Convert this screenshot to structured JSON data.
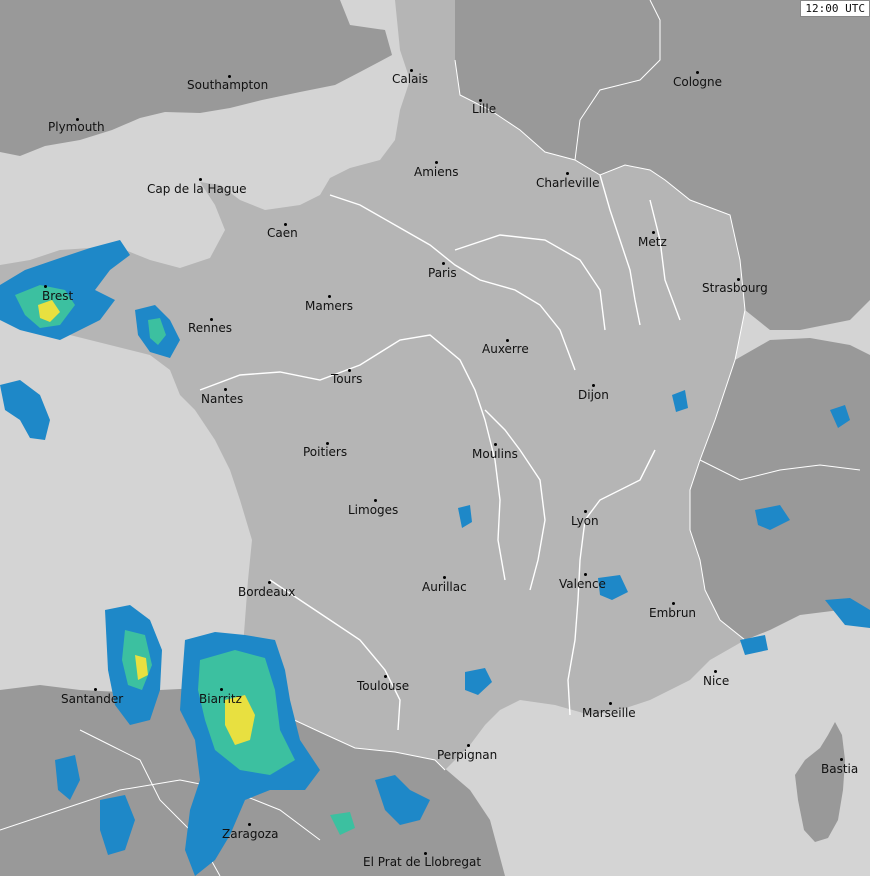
{
  "time_label": "12:00 UTC",
  "cities": {
    "southampton": "Southampton",
    "plymouth": "Plymouth",
    "calais": "Calais",
    "lille": "Lille",
    "cologne": "Cologne",
    "amiens": "Amiens",
    "charleville": "Charleville",
    "cap_de_la_hague": "Cap de la Hague",
    "caen": "Caen",
    "metz": "Metz",
    "paris": "Paris",
    "strasbourg": "Strasbourg",
    "brest": "Brest",
    "rennes": "Rennes",
    "mamers": "Mamers",
    "auxerre": "Auxerre",
    "tours": "Tours",
    "dijon": "Dijon",
    "nantes": "Nantes",
    "poitiers": "Poitiers",
    "moulins": "Moulins",
    "limoges": "Limoges",
    "lyon": "Lyon",
    "bordeaux": "Bordeaux",
    "aurillac": "Aurillac",
    "valence": "Valence",
    "embrun": "Embrun",
    "santander": "Santander",
    "biarritz": "Biarritz",
    "toulouse": "Toulouse",
    "nice": "Nice",
    "marseille": "Marseille",
    "perpignan": "Perpignan",
    "bastia": "Bastia",
    "zaragoza": "Zaragoza",
    "el_prat": "El Prat de Llobregat"
  },
  "colors": {
    "sea": "#d4d4d4",
    "france": "#b5b5b5",
    "neighbours": "#999999",
    "borders": "#ffffff",
    "radar_low": "#1e88c8",
    "radar_mid": "#3cc0a0",
    "radar_high": "#e8e040"
  }
}
